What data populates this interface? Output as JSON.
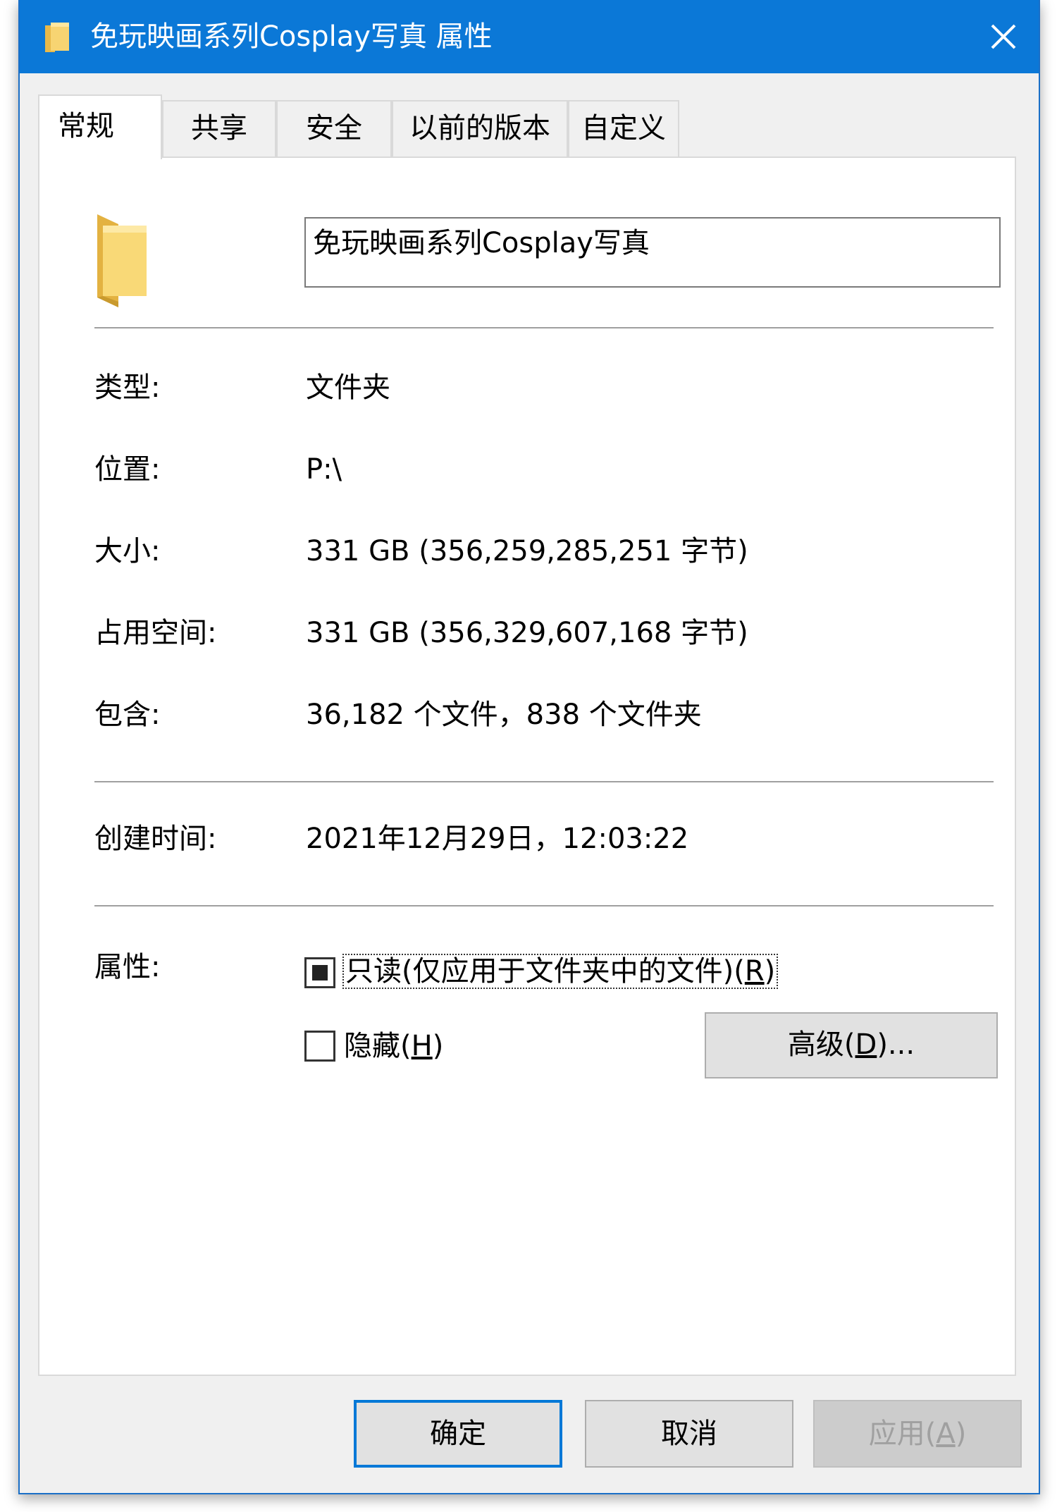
{
  "window": {
    "title": "免玩映画系列Cosplay写真 属性",
    "title_folder_icon": "folder-icon",
    "close_icon": "close-icon",
    "titlebar_color": "#0b78d7"
  },
  "tabs": [
    {
      "label": "常规",
      "active": true
    },
    {
      "label": "共享",
      "active": false
    },
    {
      "label": "安全",
      "active": false
    },
    {
      "label": "以前的版本",
      "active": false
    },
    {
      "label": "自定义",
      "active": false
    }
  ],
  "general": {
    "folder_icon": "large-folder-icon",
    "name_value": "免玩映画系列Cosplay写真",
    "rows": [
      {
        "label": "类型:",
        "value": "文件夹"
      },
      {
        "label": "位置:",
        "value": "P:\\"
      },
      {
        "label": "大小:",
        "value": "331 GB (356,259,285,251 字节)"
      },
      {
        "label": "占用空间:",
        "value": "331 GB (356,329,607,168 字节)"
      },
      {
        "label": "包含:",
        "value": "36,182 个文件，838 个文件夹"
      }
    ],
    "created": {
      "label": "创建时间:",
      "value": "2021年12月29日，12:03:22"
    },
    "attributes": {
      "label": "属性:",
      "readonly": {
        "label_prefix": "只读(仅应用于文件夹中的文件)(",
        "label_key": "R",
        "label_suffix": ")",
        "state": "indeterminate"
      },
      "hidden": {
        "label_prefix": "隐藏(",
        "label_key": "H",
        "label_suffix": ")",
        "state": "unchecked"
      },
      "advanced": {
        "label_prefix": "高级(",
        "label_key": "D",
        "label_suffix": ")..."
      }
    }
  },
  "buttons": {
    "ok": "确定",
    "cancel": "取消",
    "apply_prefix": "应用(",
    "apply_key": "A",
    "apply_suffix": ")"
  }
}
